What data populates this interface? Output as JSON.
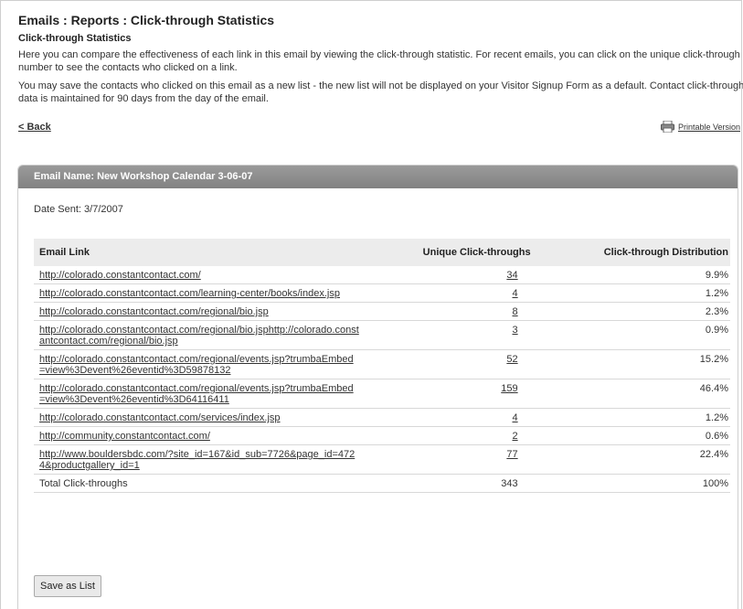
{
  "header": {
    "title": "Emails : Reports : Click-through Statistics",
    "subtitle": "Click-through Statistics",
    "paragraph1": "Here you can compare the effectiveness of each link in this email by viewing the click-through statistic. For recent emails, you can click on the unique click-through number to see the contacts who clicked on a link.",
    "paragraph2": "You may save the contacts who clicked on this email as a new list - the new list will not be displayed on your Visitor Signup Form as a default. Contact click-through data is maintained for 90 days from the day of the email."
  },
  "nav": {
    "back_label": "< Back",
    "printable_label": "Printable Version",
    "printable_icon": "printer-icon"
  },
  "panel": {
    "header_label": "Email Name:  New Workshop Calendar 3-06-07",
    "date_sent": "Date Sent:  3/7/2007"
  },
  "table": {
    "columns": [
      "Email Link",
      "Unique Click-throughs",
      "Click-through Distribution"
    ],
    "rows": [
      {
        "link": "http://colorado.constantcontact.com/",
        "clicks": "34",
        "dist": "9.9%"
      },
      {
        "link": "http://colorado.constantcontact.com/learning-center/books/index.jsp",
        "clicks": "4",
        "dist": "1.2%"
      },
      {
        "link": "http://colorado.constantcontact.com/regional/bio.jsp",
        "clicks": "8",
        "dist": "2.3%"
      },
      {
        "link": "http://colorado.constantcontact.com/regional/bio.jsphttp://colorado.constantcontact.com/regional/bio.jsp",
        "clicks": "3",
        "dist": "0.9%"
      },
      {
        "link": "http://colorado.constantcontact.com/regional/events.jsp?trumbaEmbed=view%3Devent%26eventid%3D59878132",
        "clicks": "52",
        "dist": "15.2%"
      },
      {
        "link": "http://colorado.constantcontact.com/regional/events.jsp?trumbaEmbed=view%3Devent%26eventid%3D64116411",
        "clicks": "159",
        "dist": "46.4%"
      },
      {
        "link": "http://colorado.constantcontact.com/services/index.jsp",
        "clicks": "4",
        "dist": "1.2%"
      },
      {
        "link": "http://community.constantcontact.com/",
        "clicks": "2",
        "dist": "0.6%"
      },
      {
        "link": "http://www.bouldersbdc.com/?site_id=167&id_sub=7726&page_id=4724&productgallery_id=1",
        "clicks": "77",
        "dist": "22.4%"
      }
    ],
    "total": {
      "label": "Total Click-throughs",
      "clicks": "343",
      "dist": "100%"
    }
  },
  "actions": {
    "save_label": "Save as List"
  }
}
